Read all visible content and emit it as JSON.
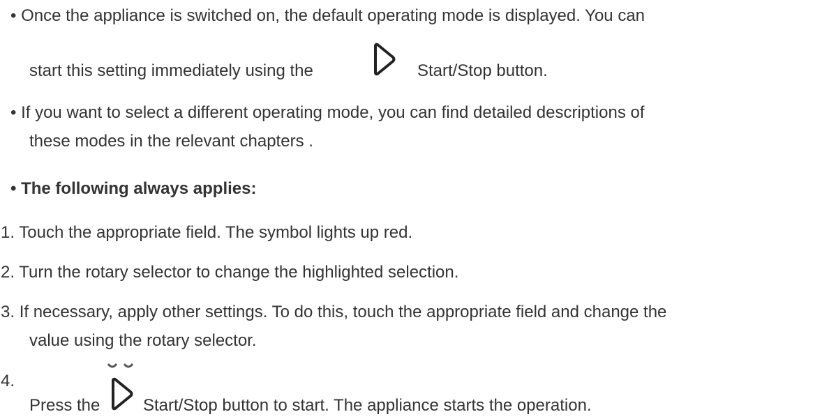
{
  "bullets": {
    "b1": {
      "marker": "•",
      "line1": "Once the appliance is switched on, the default operating mode is displayed. You can",
      "line2_before": "start this setting immediately using the",
      "line2_after": "Start/Stop button."
    },
    "b2": {
      "marker": "•",
      "line1": "If you want to select a different operating mode, you can find detailed descriptions of",
      "line2": "these modes in the relevant chapters ."
    },
    "b3": {
      "marker": "•",
      "text": "The following always applies:"
    }
  },
  "steps": {
    "s1": {
      "number": "1.",
      "text": "Touch the appropriate field. The symbol lights up red."
    },
    "s2": {
      "number": "2.",
      "text": "Turn the rotary selector to change the highlighted selection."
    },
    "s3": {
      "number": "3.",
      "line1": "If necessary, apply other settings. To do this, touch the appropriate field and change the",
      "line2": "value using the rotary selector."
    },
    "s4": {
      "number": "4.",
      "before": "Press the",
      "after": "Start/Stop button to start. The appliance starts the operation."
    }
  },
  "icons": {
    "start_stop_icon": "start-stop-icon",
    "color": "#222222"
  }
}
